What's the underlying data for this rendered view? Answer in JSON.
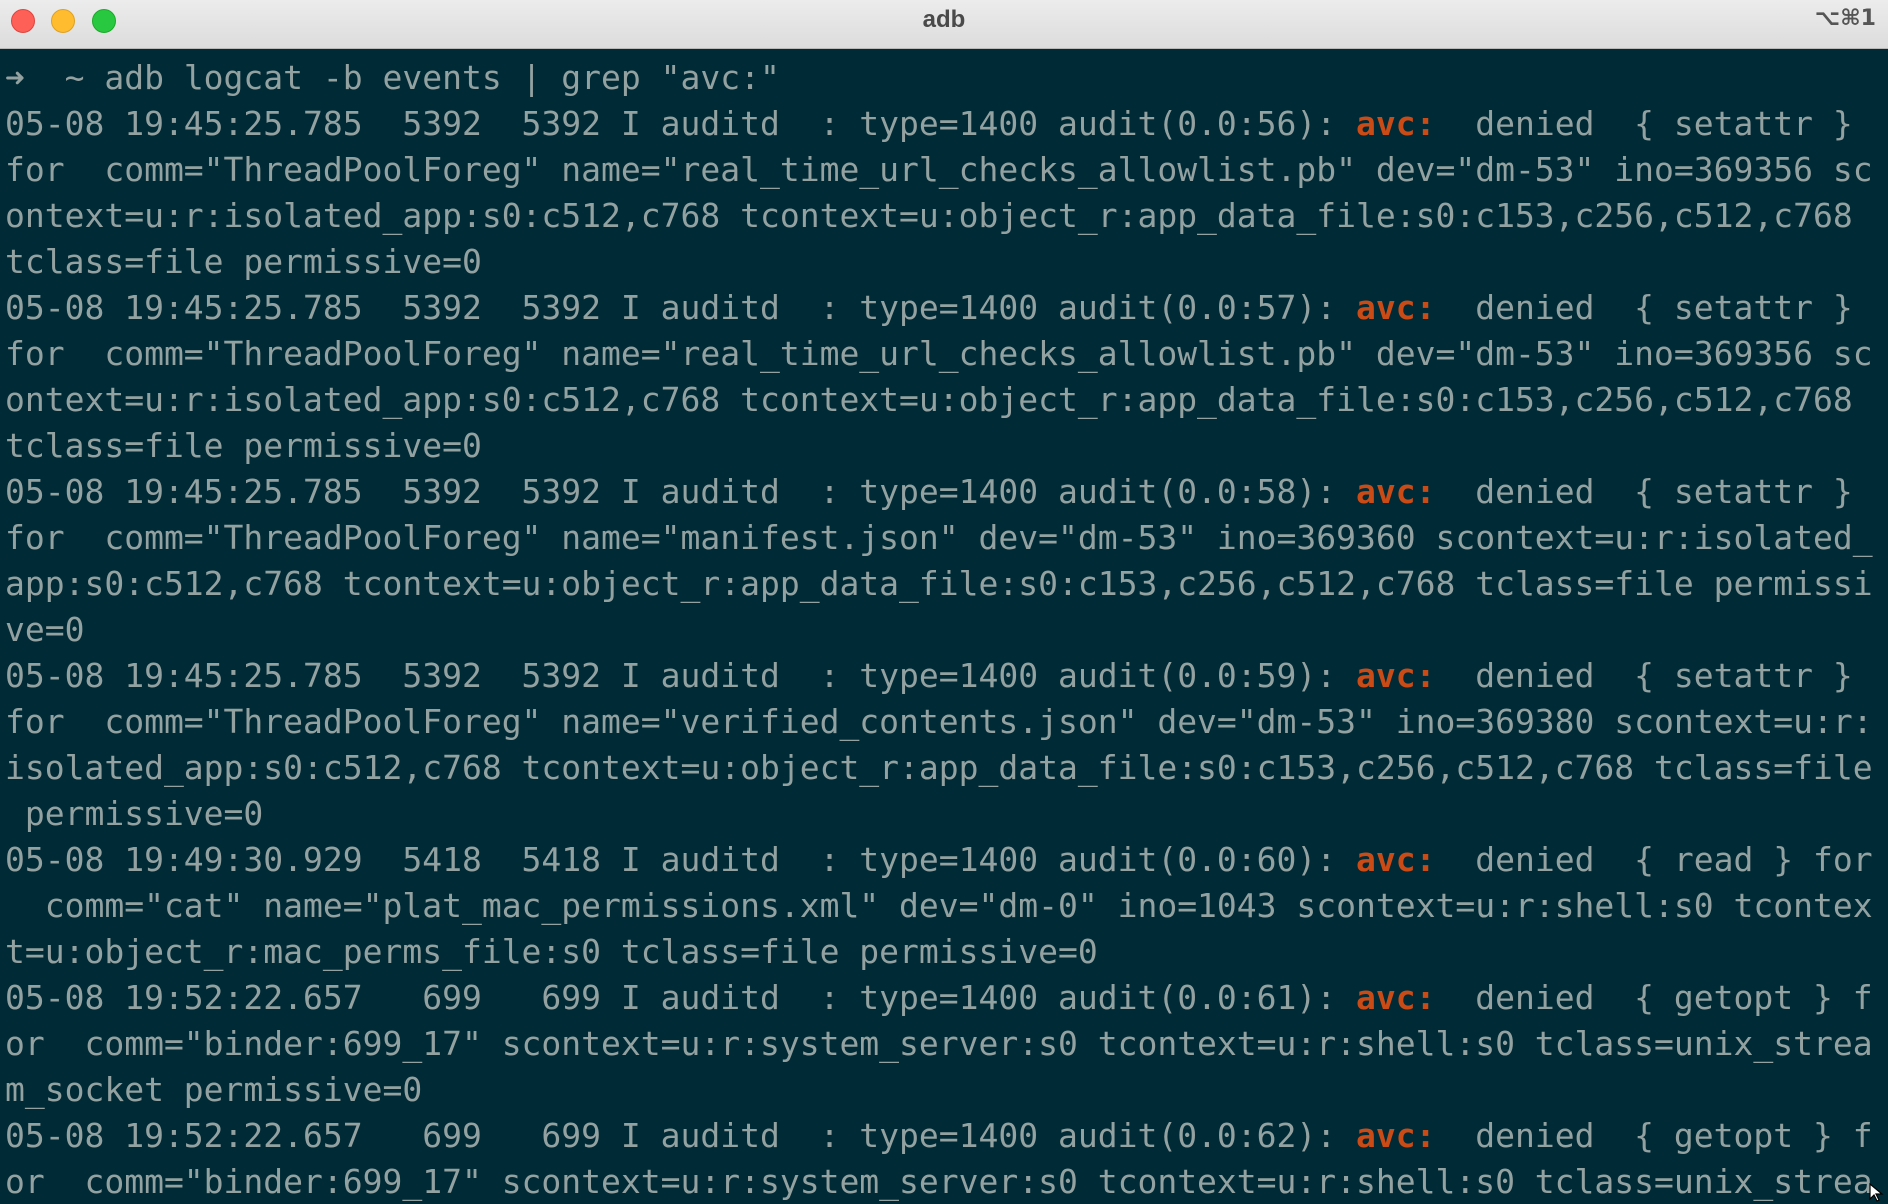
{
  "window": {
    "title": "adb",
    "shortcut": "⌥⌘1"
  },
  "terminal": {
    "prompt": {
      "arrow": "➜",
      "text": "  ~ adb logcat -b events | grep \"avc:\""
    },
    "keyword": "avc:",
    "lines": [
      {
        "pre": "05-08 19:45:25.785  5392  5392 I auditd  : type=1400 audit(0.0:56): ",
        "avc": true,
        "post": "  denied  { setattr }"
      },
      {
        "pre": "for  comm=\"ThreadPoolForeg\" name=\"real_time_url_checks_allowlist.pb\" dev=\"dm-53\" ino=369356 sc",
        "avc": false,
        "post": ""
      },
      {
        "pre": "ontext=u:r:isolated_app:s0:c512,c768 tcontext=u:object_r:app_data_file:s0:c153,c256,c512,c768",
        "avc": false,
        "post": ""
      },
      {
        "pre": "tclass=file permissive=0",
        "avc": false,
        "post": ""
      },
      {
        "pre": "05-08 19:45:25.785  5392  5392 I auditd  : type=1400 audit(0.0:57): ",
        "avc": true,
        "post": "  denied  { setattr }"
      },
      {
        "pre": "for  comm=\"ThreadPoolForeg\" name=\"real_time_url_checks_allowlist.pb\" dev=\"dm-53\" ino=369356 sc",
        "avc": false,
        "post": ""
      },
      {
        "pre": "ontext=u:r:isolated_app:s0:c512,c768 tcontext=u:object_r:app_data_file:s0:c153,c256,c512,c768",
        "avc": false,
        "post": ""
      },
      {
        "pre": "tclass=file permissive=0",
        "avc": false,
        "post": ""
      },
      {
        "pre": "05-08 19:45:25.785  5392  5392 I auditd  : type=1400 audit(0.0:58): ",
        "avc": true,
        "post": "  denied  { setattr }"
      },
      {
        "pre": "for  comm=\"ThreadPoolForeg\" name=\"manifest.json\" dev=\"dm-53\" ino=369360 scontext=u:r:isolated_",
        "avc": false,
        "post": ""
      },
      {
        "pre": "app:s0:c512,c768 tcontext=u:object_r:app_data_file:s0:c153,c256,c512,c768 tclass=file permissi",
        "avc": false,
        "post": ""
      },
      {
        "pre": "ve=0",
        "avc": false,
        "post": ""
      },
      {
        "pre": "05-08 19:45:25.785  5392  5392 I auditd  : type=1400 audit(0.0:59): ",
        "avc": true,
        "post": "  denied  { setattr }"
      },
      {
        "pre": "for  comm=\"ThreadPoolForeg\" name=\"verified_contents.json\" dev=\"dm-53\" ino=369380 scontext=u:r:",
        "avc": false,
        "post": ""
      },
      {
        "pre": "isolated_app:s0:c512,c768 tcontext=u:object_r:app_data_file:s0:c153,c256,c512,c768 tclass=file",
        "avc": false,
        "post": ""
      },
      {
        "pre": " permissive=0",
        "avc": false,
        "post": ""
      },
      {
        "pre": "05-08 19:49:30.929  5418  5418 I auditd  : type=1400 audit(0.0:60): ",
        "avc": true,
        "post": "  denied  { read } for"
      },
      {
        "pre": "  comm=\"cat\" name=\"plat_mac_permissions.xml\" dev=\"dm-0\" ino=1043 scontext=u:r:shell:s0 tcontex",
        "avc": false,
        "post": ""
      },
      {
        "pre": "t=u:object_r:mac_perms_file:s0 tclass=file permissive=0",
        "avc": false,
        "post": ""
      },
      {
        "pre": "05-08 19:52:22.657   699   699 I auditd  : type=1400 audit(0.0:61): ",
        "avc": true,
        "post": "  denied  { getopt } f"
      },
      {
        "pre": "or  comm=\"binder:699_17\" scontext=u:r:system_server:s0 tcontext=u:r:shell:s0 tclass=unix_strea",
        "avc": false,
        "post": ""
      },
      {
        "pre": "m_socket permissive=0",
        "avc": false,
        "post": ""
      },
      {
        "pre": "05-08 19:52:22.657   699   699 I auditd  : type=1400 audit(0.0:62): ",
        "avc": true,
        "post": "  denied  { getopt } f"
      },
      {
        "pre": "or  comm=\"binder:699_17\" scontext=u:r:system_server:s0 tcontext=u:r:shell:s0 tclass=unix_strea",
        "avc": false,
        "post": ""
      }
    ]
  }
}
